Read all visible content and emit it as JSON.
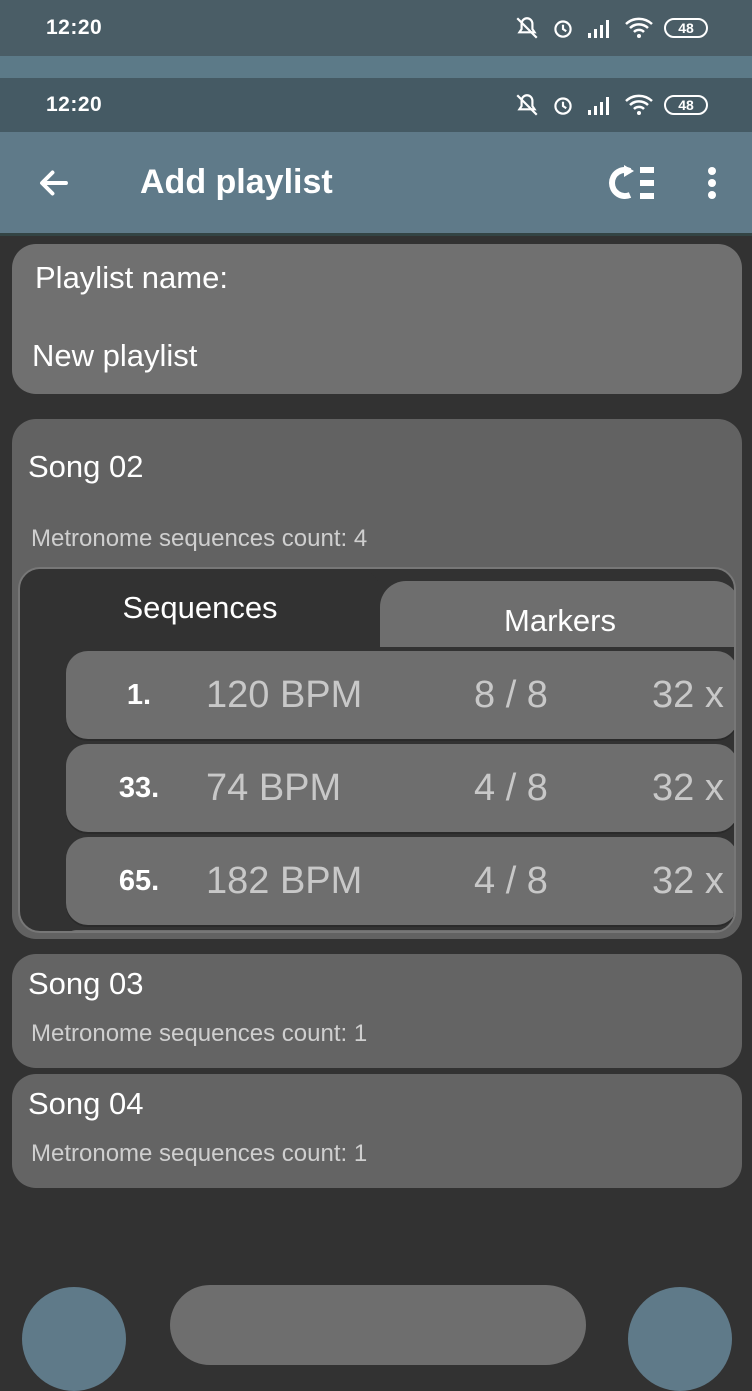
{
  "status_bar": {
    "time": "12:20",
    "battery": "48"
  },
  "app_bar": {
    "title": "Add playlist"
  },
  "playlist": {
    "label": "Playlist name:",
    "value": "New playlist"
  },
  "songs": [
    {
      "title": "Song 02",
      "count_text": "Metronome sequences count: 4",
      "tabs": [
        "Sequences",
        "Markers"
      ],
      "sequences": [
        {
          "num": "1.",
          "bpm": "120 BPM",
          "sig": "8 / 8",
          "rep": "32 x"
        },
        {
          "num": "33.",
          "bpm": "74 BPM",
          "sig": "4 / 8",
          "rep": "32 x"
        },
        {
          "num": "65.",
          "bpm": "182 BPM",
          "sig": "4 / 8",
          "rep": "32 x"
        }
      ]
    },
    {
      "title": "Song 03",
      "count_text": "Metronome sequences count: 1"
    },
    {
      "title": "Song 04",
      "count_text": "Metronome sequences count: 1"
    }
  ],
  "icons": {
    "back": "arrow-left-icon",
    "reorder": "shuffle-list-icon",
    "more": "more-vert-icon"
  },
  "colors": {
    "app_bar": "#5f7a89",
    "background": "#323232",
    "card": "#6e6e6e"
  }
}
